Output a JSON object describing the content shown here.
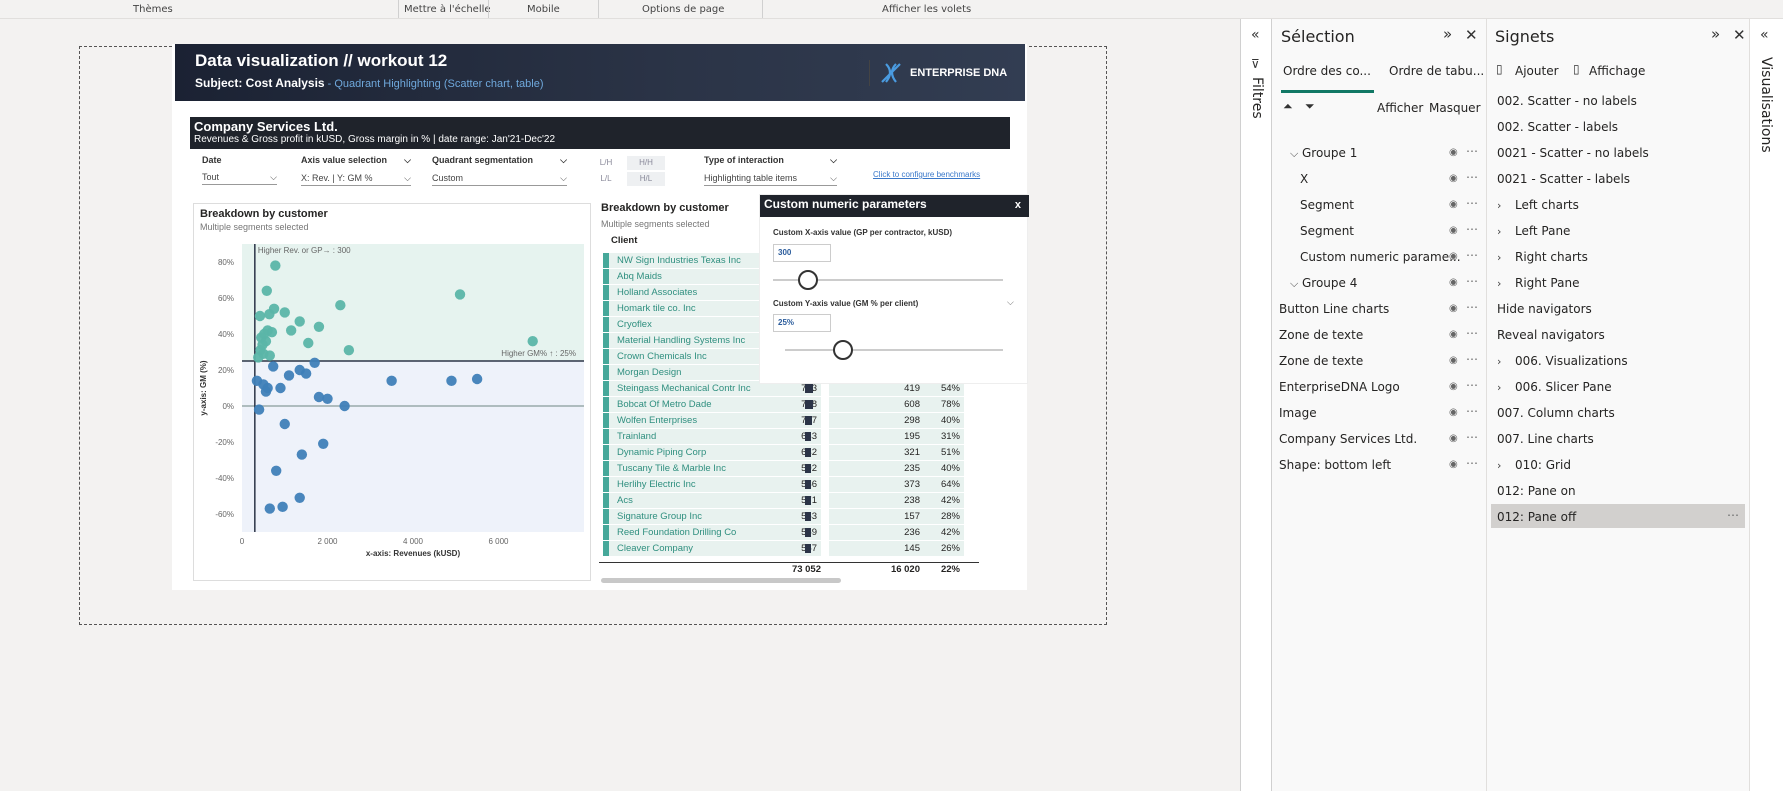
{
  "ribbon": {
    "groups": [
      "Thèmes",
      "Mettre à l'échelle",
      "Mobile",
      "Options de page",
      "Afficher les volets"
    ]
  },
  "report": {
    "title": "Data visualization // workout 12",
    "subject": "Subject: Cost Analysis",
    "subject_detail": " - Quadrant Highlighting (Scatter chart, table)",
    "logo_text": "ENTERPRISE DNA",
    "company": "Company Services Ltd.",
    "company_sub": "Revenues & Gross profit in kUSD, Gross margin in % | date range: Jan'21-Dec'22",
    "slicers": [
      {
        "label": "Date",
        "value": "Tout"
      },
      {
        "label": "Axis value selection",
        "value": "X: Rev. | Y: GM %"
      },
      {
        "label": "Quadrant segmentation",
        "value": "Custom"
      },
      {
        "label": "Type of interaction",
        "value": "Highlighting table items"
      }
    ],
    "quadrants": [
      "L/H",
      "H/H",
      "L/L",
      "H/L"
    ],
    "benchmark_link": "Click to configure benchmarks",
    "scatter": {
      "title": "Breakdown by customer",
      "subtitle": "Multiple segments selected",
      "annotation_x": "Higher Rev. or GP→ : 300",
      "annotation_y": "Higher GM% ↑ : 25%",
      "xlabel": "x-axis: Revenues (kUSD)",
      "ylabel": "y-axis: GM (%)",
      "xticks": [
        "0",
        "2 000",
        "4 000",
        "6 000"
      ],
      "yticks": [
        "80%",
        "60%",
        "40%",
        "20%",
        "0%",
        "-20%",
        "-40%",
        "-60%"
      ]
    },
    "table": {
      "title": "Breakdown by customer",
      "subtitle": "Multiple segments selected",
      "col_client": "Client",
      "rows": [
        {
          "client": "NW Sign Industries Texas Inc",
          "rev": "",
          "gp": "",
          "gm": ""
        },
        {
          "client": "Abq Maids",
          "rev": "",
          "gp": "",
          "gm": ""
        },
        {
          "client": "Holland Associates",
          "rev": "",
          "gp": "",
          "gm": ""
        },
        {
          "client": "Homark tile co. Inc",
          "rev": "",
          "gp": "",
          "gm": ""
        },
        {
          "client": "Cryoflex",
          "rev": "",
          "gp": "",
          "gm": ""
        },
        {
          "client": "Material Handling Systems Inc",
          "rev": "",
          "gp": "",
          "gm": ""
        },
        {
          "client": "Crown Chemicals Inc",
          "rev": "",
          "gp": "",
          "gm": ""
        },
        {
          "client": "Morgan Design",
          "rev": "",
          "gp": "",
          "gm": ""
        },
        {
          "client": "Steingass Mechanical Contr Inc",
          "rev": "783",
          "gp": "419",
          "gm": "54%"
        },
        {
          "client": "Bobcat Of Metro Dade",
          "rev": "778",
          "gp": "608",
          "gm": "78%"
        },
        {
          "client": "Wolfen Enterprises",
          "rev": "737",
          "gp": "298",
          "gm": "40%"
        },
        {
          "client": "Trainland",
          "rev": "633",
          "gp": "195",
          "gm": "31%"
        },
        {
          "client": "Dynamic Piping Corp",
          "rev": "632",
          "gp": "321",
          "gm": "51%"
        },
        {
          "client": "Tuscany Tile & Marble Inc",
          "rev": "592",
          "gp": "235",
          "gm": "40%"
        },
        {
          "client": "Herlihy Electric Inc",
          "rev": "586",
          "gp": "373",
          "gm": "64%"
        },
        {
          "client": "Acs",
          "rev": "571",
          "gp": "238",
          "gm": "42%"
        },
        {
          "client": "Signature Group Inc",
          "rev": "563",
          "gp": "157",
          "gm": "28%"
        },
        {
          "client": "Reed Foundation Drilling Co",
          "rev": "559",
          "gp": "236",
          "gm": "42%"
        },
        {
          "client": "Cleaver Company",
          "rev": "557",
          "gp": "145",
          "gm": "26%"
        }
      ],
      "total_rev": "73 052",
      "total_gp": "16 020",
      "total_gm": "22%"
    },
    "params": {
      "title": "Custom numeric parameters",
      "close": "x",
      "x_label": "Custom X-axis value (GP per contractor, kUSD)",
      "x_value": "300",
      "y_label": "Custom Y-axis value (GM % per client)",
      "y_value": "25%"
    }
  },
  "filters_pane": {
    "label": "Filtres"
  },
  "selection_pane": {
    "title": "Sélection",
    "tabs": [
      "Ordre des co...",
      "Ordre de tabu..."
    ],
    "show": "Afficher",
    "hide": "Masquer",
    "items": [
      {
        "label": "Groupe 1",
        "indent": 1,
        "chevron": "open"
      },
      {
        "label": "X",
        "indent": 2,
        "chevron": ""
      },
      {
        "label": "Segment",
        "indent": 2,
        "chevron": ""
      },
      {
        "label": "Segment",
        "indent": 2,
        "chevron": ""
      },
      {
        "label": "Custom numeric parame...",
        "indent": 2,
        "chevron": ""
      },
      {
        "label": "Groupe 4",
        "indent": 1,
        "chevron": "open"
      },
      {
        "label": "Button Line charts",
        "indent": 0,
        "chevron": ""
      },
      {
        "label": "Zone de texte",
        "indent": 0,
        "chevron": ""
      },
      {
        "label": "Zone de texte",
        "indent": 0,
        "chevron": ""
      },
      {
        "label": "EnterpriseDNA Logo",
        "indent": 0,
        "chevron": ""
      },
      {
        "label": "Image",
        "indent": 0,
        "chevron": ""
      },
      {
        "label": "Company Services Ltd.",
        "indent": 0,
        "chevron": ""
      },
      {
        "label": "Shape: bottom left",
        "indent": 0,
        "chevron": ""
      }
    ]
  },
  "bookmarks_pane": {
    "title": "Signets",
    "add": "Ajouter",
    "view": "Affichage",
    "items": [
      {
        "label": "002. Scatter - no labels",
        "chevron": false
      },
      {
        "label": "002. Scatter - labels",
        "chevron": false
      },
      {
        "label": "0021 - Scatter - no labels",
        "chevron": false
      },
      {
        "label": "0021 - Scatter - labels",
        "chevron": false
      },
      {
        "label": "Left charts",
        "chevron": true
      },
      {
        "label": "Left Pane",
        "chevron": true
      },
      {
        "label": "Right charts",
        "chevron": true
      },
      {
        "label": "Right Pane",
        "chevron": true
      },
      {
        "label": "Hide navigators",
        "chevron": false
      },
      {
        "label": "Reveal navigators",
        "chevron": false
      },
      {
        "label": "006. Visualizations",
        "chevron": true
      },
      {
        "label": "006. Slicer Pane",
        "chevron": true
      },
      {
        "label": "007. Column charts",
        "chevron": false
      },
      {
        "label": "007. Line charts",
        "chevron": false
      },
      {
        "label": "010: Grid",
        "chevron": true
      },
      {
        "label": "012: Pane on",
        "chevron": false
      },
      {
        "label": "012: Pane off",
        "chevron": false,
        "selected": true
      }
    ]
  },
  "visualizations_pane": {
    "label": "Visualisations"
  },
  "chart_data": {
    "type": "scatter",
    "title": "Breakdown by customer",
    "xlabel": "x-axis: Revenues (kUSD)",
    "ylabel": "y-axis: GM (%)",
    "xlim": [
      0,
      8000
    ],
    "ylim": [
      -70,
      90
    ],
    "x_threshold": 300,
    "y_threshold": 25,
    "colors": {
      "high": "#5bb5a8",
      "low": "#3f7fb8"
    },
    "points": [
      {
        "x": 780,
        "y": 78
      },
      {
        "x": 580,
        "y": 64
      },
      {
        "x": 750,
        "y": 54
      },
      {
        "x": 640,
        "y": 51
      },
      {
        "x": 420,
        "y": 50
      },
      {
        "x": 1000,
        "y": 52
      },
      {
        "x": 1350,
        "y": 47
      },
      {
        "x": 1150,
        "y": 42
      },
      {
        "x": 1800,
        "y": 44
      },
      {
        "x": 2300,
        "y": 56
      },
      {
        "x": 5100,
        "y": 62
      },
      {
        "x": 6800,
        "y": 36
      },
      {
        "x": 600,
        "y": 42
      },
      {
        "x": 700,
        "y": 41
      },
      {
        "x": 520,
        "y": 40
      },
      {
        "x": 450,
        "y": 38
      },
      {
        "x": 560,
        "y": 36
      },
      {
        "x": 480,
        "y": 34
      },
      {
        "x": 1550,
        "y": 35
      },
      {
        "x": 2500,
        "y": 31
      },
      {
        "x": 430,
        "y": 31
      },
      {
        "x": 500,
        "y": 29
      },
      {
        "x": 650,
        "y": 28
      },
      {
        "x": 380,
        "y": 27
      },
      {
        "x": 1700,
        "y": 24
      },
      {
        "x": 730,
        "y": 22
      },
      {
        "x": 1350,
        "y": 20
      },
      {
        "x": 1500,
        "y": 18
      },
      {
        "x": 1100,
        "y": 17
      },
      {
        "x": 3500,
        "y": 14
      },
      {
        "x": 4900,
        "y": 14
      },
      {
        "x": 5500,
        "y": 15
      },
      {
        "x": 350,
        "y": 14
      },
      {
        "x": 500,
        "y": 12
      },
      {
        "x": 900,
        "y": 10
      },
      {
        "x": 600,
        "y": 10
      },
      {
        "x": 560,
        "y": 8
      },
      {
        "x": 1800,
        "y": 5
      },
      {
        "x": 2000,
        "y": 4
      },
      {
        "x": 2400,
        "y": 0
      },
      {
        "x": 400,
        "y": -2
      },
      {
        "x": 1000,
        "y": -10
      },
      {
        "x": 1900,
        "y": -21
      },
      {
        "x": 1400,
        "y": -27
      },
      {
        "x": 800,
        "y": -36
      },
      {
        "x": 1350,
        "y": -51
      },
      {
        "x": 950,
        "y": -56
      },
      {
        "x": 650,
        "y": -57
      }
    ]
  }
}
